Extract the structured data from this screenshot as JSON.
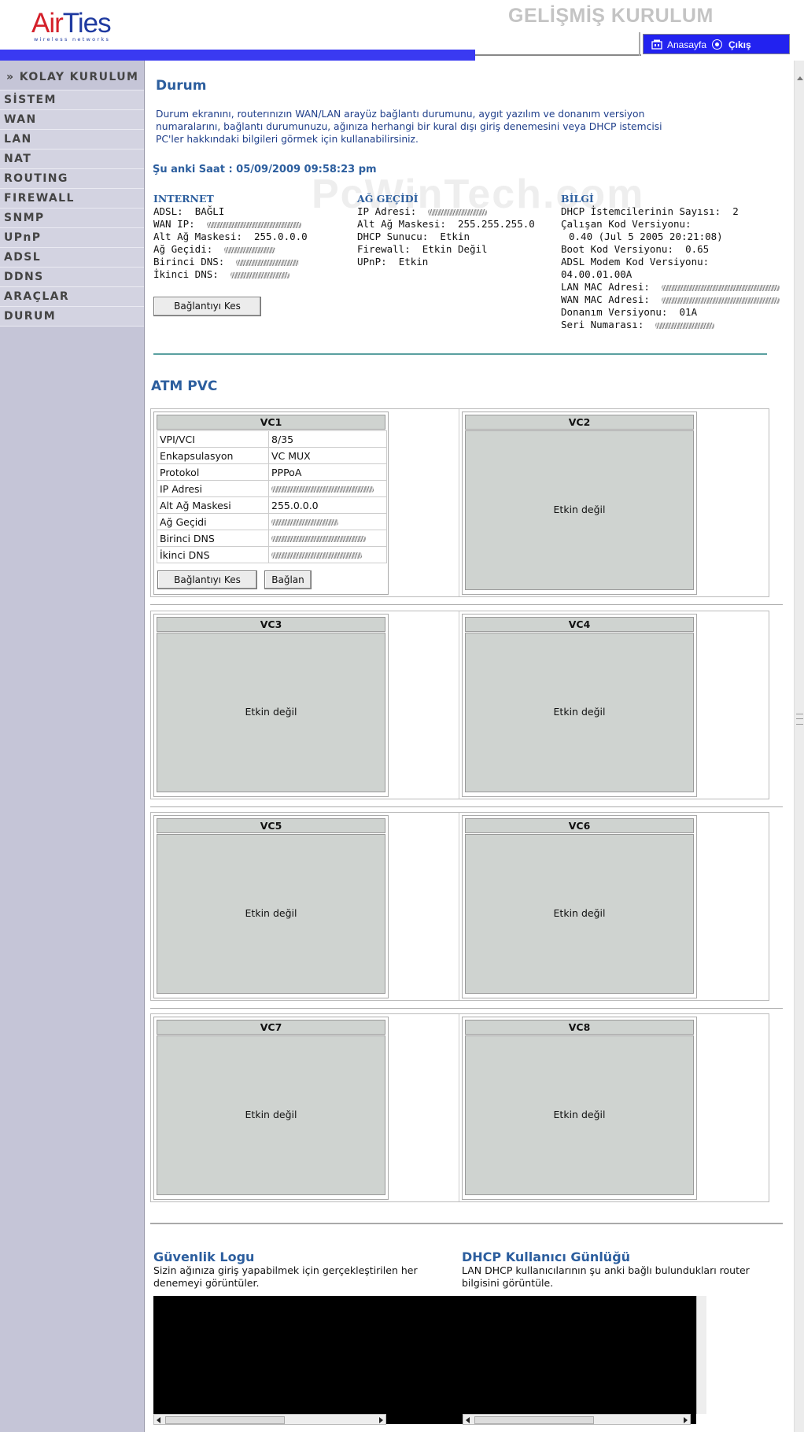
{
  "header": {
    "brand_prefix": "Air",
    "brand_suffix": "Ties",
    "brand_tagline": "wireless networks",
    "title": "GELİŞMİŞ KURULUM",
    "home_link": "Anasayfa",
    "exit_link": "Çıkış",
    "accent_color": "#3a3af2"
  },
  "sidebar": {
    "items": [
      {
        "label": "» KOLAY KURULUM"
      },
      {
        "label": "SİSTEM"
      },
      {
        "label": "WAN"
      },
      {
        "label": "LAN"
      },
      {
        "label": "NAT"
      },
      {
        "label": "ROUTING"
      },
      {
        "label": "FIREWALL"
      },
      {
        "label": "SNMP"
      },
      {
        "label": "UPnP"
      },
      {
        "label": "ADSL"
      },
      {
        "label": "DDNS"
      },
      {
        "label": "ARAÇLAR"
      },
      {
        "label": "DURUM"
      }
    ]
  },
  "main": {
    "title": "Durum",
    "intro": "Durum ekranını, routerınızın WAN/LAN arayüz bağlantı durumunu, aygıt yazılım ve donanım versiyon numaralarını, bağlantı durumunuzu, ağınıza herhangi bir kural dışı giriş denemesini veya DHCP istemcisi PC'ler hakkındaki bilgileri görmek için kullanabilirsiniz.",
    "clock": "Şu anki Saat : 05/09/2009 09:58:23 pm",
    "watermark": "PcWinTech.com",
    "internet": {
      "title": "INTERNET",
      "adsl_label": "ADSL:",
      "adsl_value": "BAĞLI",
      "wan_ip_label": "WAN IP:",
      "subnet_label": "Alt Ağ Maskesi:",
      "subnet_value": "255.0.0.0",
      "gateway_label": "Ağ Geçidi:",
      "dns1_label": "Birinci DNS:",
      "dns2_label": "İkinci DNS:"
    },
    "gateway": {
      "title": "AĞ GEÇİDİ",
      "ip_label": "IP Adresi:",
      "subnet_label": "Alt Ağ Maskesi:",
      "subnet_value": "255.255.255.0",
      "dhcp_label": "DHCP Sunucu:",
      "dhcp_value": "Etkin",
      "firewall_label": "Firewall:",
      "firewall_value": "Etkin Değil",
      "upnp_label": "UPnP:",
      "upnp_value": "Etkin"
    },
    "info": {
      "title": "BİLGİ",
      "dhcp_clients_label": "DHCP İstemcilerinin Sayısı:",
      "dhcp_clients_value": "2",
      "running_code_label": "Çalışan Kod Versiyonu:",
      "running_code_value": "0.40 (Jul 5 2005 20:21:08)",
      "boot_code_label": "Boot Kod Versiyonu:",
      "boot_code_value": "0.65",
      "adsl_modem_label": "ADSL Modem Kod Versiyonu:",
      "adsl_modem_value": "04.00.01.00A",
      "lan_mac_label": "LAN MAC Adresi:",
      "wan_mac_label": "WAN MAC Adresi:",
      "hw_version_label": "Donanım Versiyonu:",
      "hw_version_value": "01A",
      "serial_label": "Seri Numarası:"
    },
    "disconnect_button": "Bağlantıyı Kes"
  },
  "atm": {
    "title": "ATM PVC",
    "vc1": {
      "title": "VC1",
      "rows": [
        {
          "key": "VPI/VCI",
          "value": "8/35"
        },
        {
          "key": "Enkapsulasyon",
          "value": "VC MUX"
        },
        {
          "key": "Protokol",
          "value": "PPPoA"
        },
        {
          "key": "IP Adresi",
          "value": ""
        },
        {
          "key": "Alt Ağ Maskesi",
          "value": "255.0.0.0"
        },
        {
          "key": "Ağ Geçidi",
          "value": ""
        },
        {
          "key": "Birinci DNS",
          "value": ""
        },
        {
          "key": "İkinci DNS",
          "value": ""
        }
      ],
      "disconnect_button": "Bağlantıyı Kes",
      "connect_button": "Bağlan"
    },
    "inactive_text": "Etkin değil",
    "vc_titles": [
      "VC2",
      "VC3",
      "VC4",
      "VC5",
      "VC6",
      "VC7",
      "VC8"
    ]
  },
  "logs": {
    "security_title": "Güvenlik Logu",
    "security_desc": "Sizin ağınıza giriş yapabilmek için gerçekleştirilen her denemeyi görüntüler.",
    "dhcp_title": "DHCP Kullanıcı Günlüğü",
    "dhcp_desc": "LAN DHCP kullanıcılarının şu anki bağlı bulundukları router bilgisini görüntüle."
  }
}
